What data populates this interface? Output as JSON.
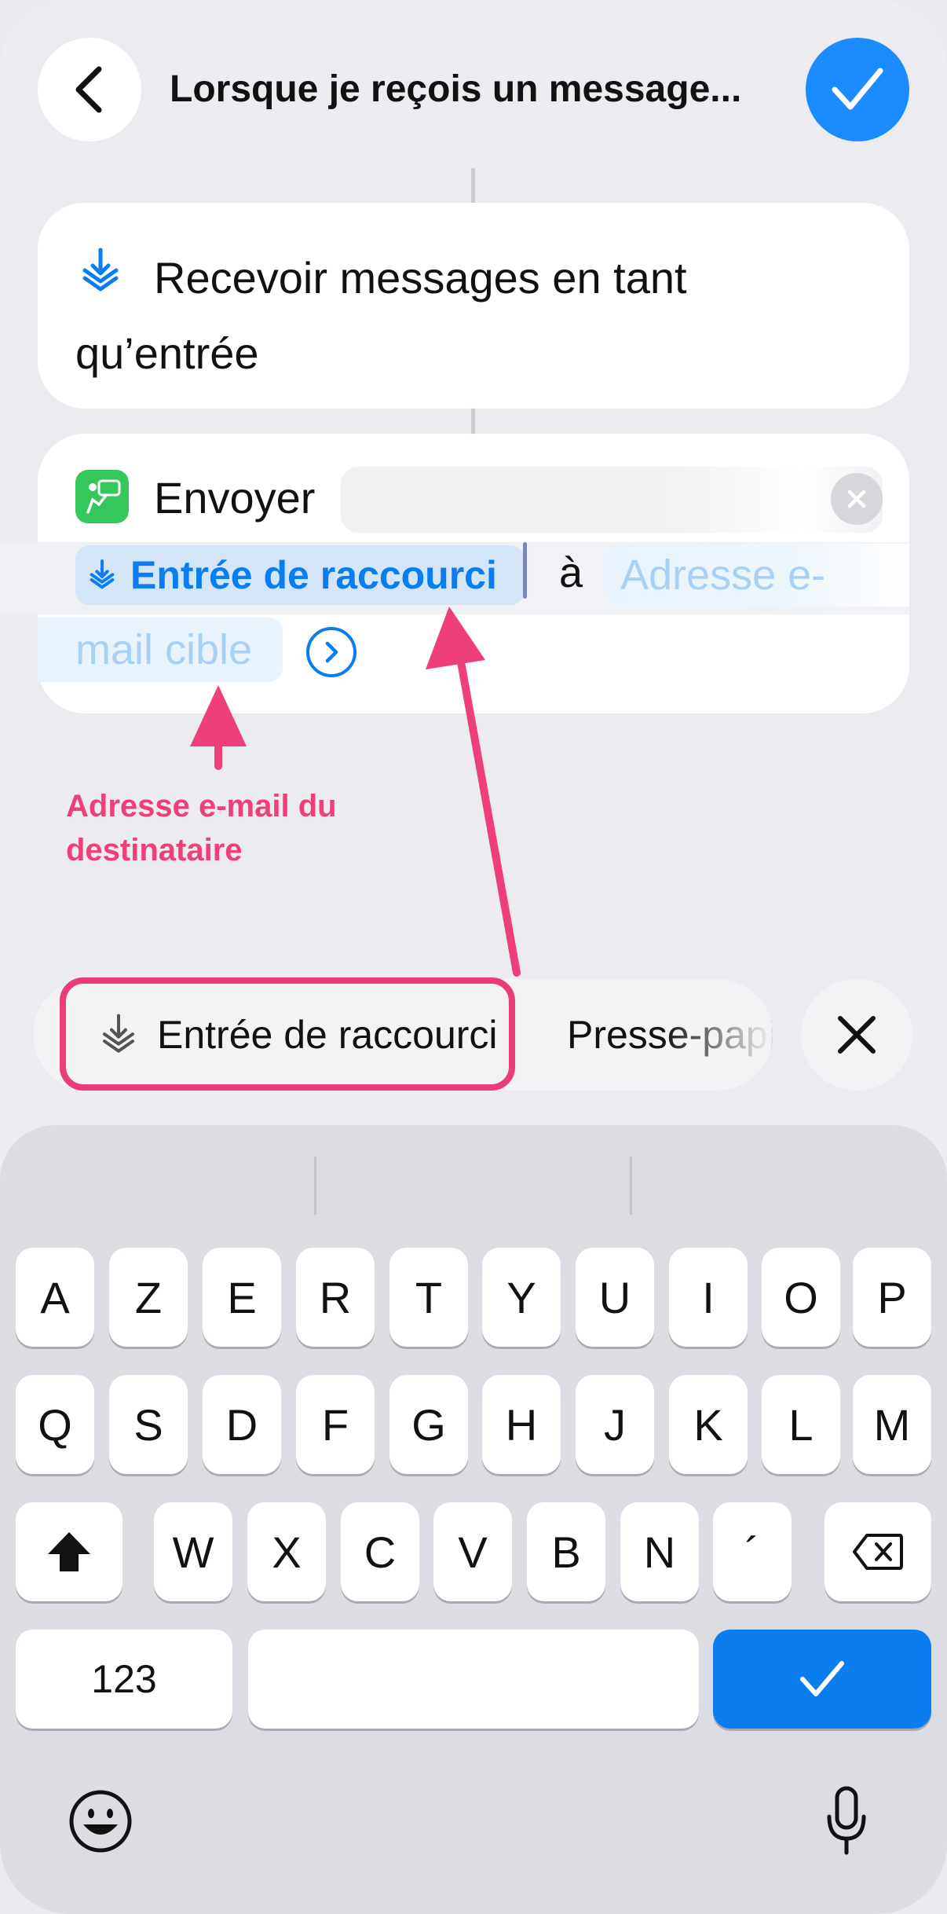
{
  "header": {
    "title": "Lorsque je reçois un message..."
  },
  "actions": {
    "receive": {
      "label": "Recevoir messages en tant qu’entrée",
      "icon": "shortcut-input-icon"
    },
    "send": {
      "verb": "Envoyer",
      "message_value": "",
      "token_label": "Entrée de raccourci",
      "preposition": "à",
      "email_placeholder_line1": "Adresse e-",
      "email_placeholder_line2": "mail cible",
      "app_icon": "messages-app-icon"
    }
  },
  "annotation": {
    "label": "Adresse e-mail du destinataire",
    "color": "#ef3f7a"
  },
  "suggestions": {
    "items": [
      {
        "label": "Entrée de raccourci",
        "icon": "shortcut-input-icon"
      },
      {
        "label": "Presse-papiers",
        "icon": "clipboard-icon"
      }
    ]
  },
  "keyboard": {
    "row1": [
      "A",
      "Z",
      "E",
      "R",
      "T",
      "Y",
      "U",
      "I",
      "O",
      "P"
    ],
    "row2": [
      "Q",
      "S",
      "D",
      "F",
      "G",
      "H",
      "J",
      "K",
      "L",
      "M"
    ],
    "row3": [
      "W",
      "X",
      "C",
      "V",
      "B",
      "N",
      "´"
    ],
    "numbers_label": "123"
  },
  "colors": {
    "accent": "#0a7ef0",
    "done_button": "#1a8cff",
    "highlight": "#e93c78"
  }
}
